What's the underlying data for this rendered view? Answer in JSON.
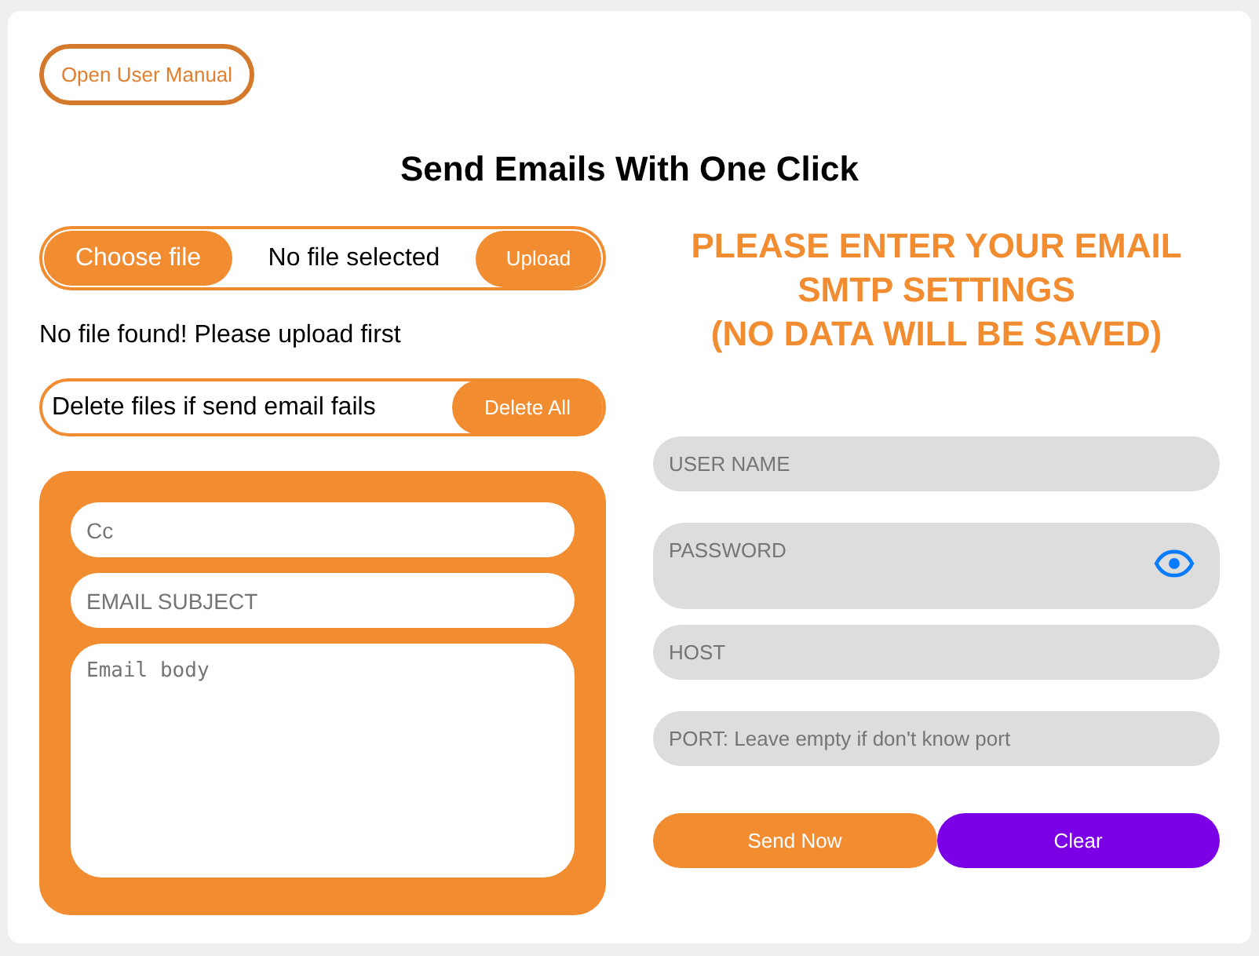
{
  "manual_button": "Open User Manual",
  "title": "Send Emails With One Click",
  "file_upload": {
    "choose_label": "Choose file",
    "status": "No file selected",
    "upload_label": "Upload"
  },
  "upload_message": "No file found! Please upload first",
  "delete_row": {
    "label": "Delete files if send email fails",
    "button": "Delete All"
  },
  "email_form": {
    "cc_placeholder": "Cc",
    "subject_placeholder": "EMAIL SUBJECT",
    "body_placeholder": "Email body"
  },
  "smtp_heading": [
    "PLEASE ENTER YOUR EMAIL",
    "SMTP SETTINGS",
    "(NO DATA WILL BE SAVED)"
  ],
  "smtp_fields": [
    {
      "kind": "text",
      "placeholder": "USER NAME"
    },
    {
      "kind": "password",
      "placeholder": "PASSWORD"
    },
    {
      "kind": "text",
      "placeholder": "HOST"
    },
    {
      "kind": "text",
      "placeholder": "PORT: Leave empty if don't know port"
    }
  ],
  "buttons": [
    {
      "kind": "primary",
      "label": "Send Now"
    },
    {
      "kind": "secondary",
      "label": "Clear"
    }
  ]
}
